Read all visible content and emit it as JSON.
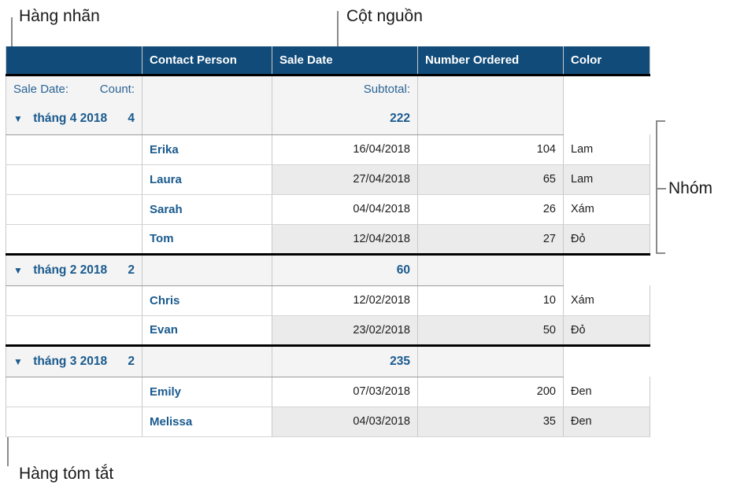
{
  "annotations": {
    "label_row": "Hàng nhãn",
    "source_column": "Cột nguồn",
    "group": "Nhóm",
    "summary_row": "Hàng tóm tắt"
  },
  "table": {
    "columns": [
      "",
      "Contact Person",
      "Sale Date",
      "Number Ordered",
      "Color"
    ],
    "field_row": {
      "label_field": "Sale Date:",
      "count_label": "Count:",
      "date_label": "",
      "subtotal_label": "Subtotal:",
      "color_label": ""
    },
    "disclosure_glyph": "▼",
    "groups": [
      {
        "title": "tháng 4 2018",
        "count": "4",
        "subtotal": "222",
        "rows": [
          {
            "name": "Erika",
            "date": "16/04/2018",
            "number": "104",
            "color": "Lam"
          },
          {
            "name": "Laura",
            "date": "27/04/2018",
            "number": "65",
            "color": "Lam"
          },
          {
            "name": "Sarah",
            "date": "04/04/2018",
            "number": "26",
            "color": "Xám"
          },
          {
            "name": "Tom",
            "date": "12/04/2018",
            "number": "27",
            "color": "Đỏ"
          }
        ]
      },
      {
        "title": "tháng 2 2018",
        "count": "2",
        "subtotal": "60",
        "rows": [
          {
            "name": "Chris",
            "date": "12/02/2018",
            "number": "10",
            "color": "Xám"
          },
          {
            "name": "Evan",
            "date": "23/02/2018",
            "number": "50",
            "color": "Đỏ"
          }
        ]
      },
      {
        "title": "tháng 3 2018",
        "count": "2",
        "subtotal": "235",
        "rows": [
          {
            "name": "Emily",
            "date": "07/03/2018",
            "number": "200",
            "color": "Đen"
          },
          {
            "name": "Melissa",
            "date": "04/03/2018",
            "number": "35",
            "color": "Đen"
          }
        ]
      }
    ]
  },
  "colors": {
    "header_blue": "#114b79",
    "link_blue": "#1a5a8e",
    "field_blue": "#2a6496",
    "summary_bg": "#f4f4f4",
    "stripe": "#ebebeb",
    "rule": "#000000",
    "leader": "#8a8a8a"
  }
}
